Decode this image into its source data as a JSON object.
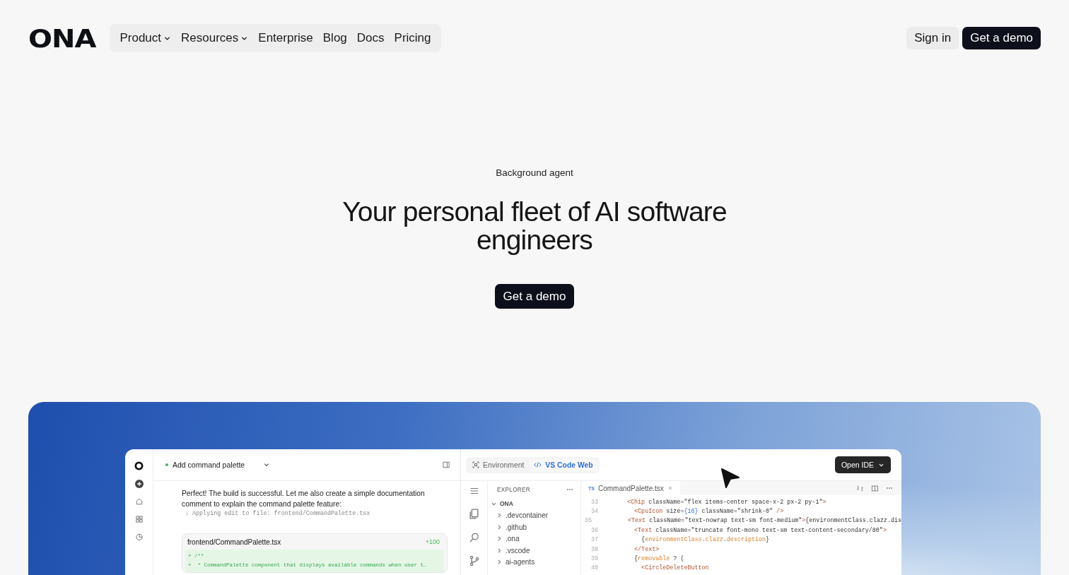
{
  "header": {
    "logo": "ONA",
    "nav": [
      {
        "label": "Product",
        "dropdown": true
      },
      {
        "label": "Resources",
        "dropdown": true
      },
      {
        "label": "Enterprise",
        "dropdown": false
      },
      {
        "label": "Blog",
        "dropdown": false
      },
      {
        "label": "Docs",
        "dropdown": false
      },
      {
        "label": "Pricing",
        "dropdown": false
      }
    ],
    "actions": [
      {
        "label": "Sign in",
        "kind": "secondary"
      },
      {
        "label": "Get a demo",
        "kind": "primary"
      }
    ]
  },
  "hero": {
    "eyebrow": "Background agent",
    "title": "Your personal fleet of AI software engineers",
    "button": "Get a demo"
  },
  "app": {
    "chat": {
      "task": "Add command palette",
      "message": "Perfect! The build is successful. Let me also create a simple documentation comment to explain the command palette feature:",
      "step": "Applying edit to file: frontend/CommandPalette.tsx",
      "diff": {
        "file": "frontend/CommandPalette.tsx",
        "added": "+100",
        "lines": [
          "+ /**",
          "+  * CommandPalette component that displays available commands when user t…"
        ]
      }
    },
    "ide": {
      "tabs": [
        {
          "label": "Environment",
          "selected": false
        },
        {
          "label": "VS Code Web",
          "selected": true
        }
      ],
      "open_button": "Open IDE",
      "explorer": {
        "title": "EXPLORER",
        "root": {
          "label": "ONA",
          "expanded": true,
          "children": [
            {
              "label": ".devcontainer",
              "expanded": false
            },
            {
              "label": ".github",
              "expanded": false
            },
            {
              "label": ".ona",
              "expanded": false
            },
            {
              "label": ".vscode",
              "expanded": false
            },
            {
              "label": "ai-agents",
              "expanded": false
            }
          ]
        }
      },
      "editor_tab": {
        "lang": "TS",
        "file": "CommandPalette.tsx"
      },
      "code": [
        {
          "number": "33",
          "tokens": [
            {
              "kind": "tag",
              "text": "<Chip"
            },
            {
              "kind": "plain",
              "text": " className="
            },
            {
              "kind": "str",
              "text": "\"flex items-center space-x-2 px-2 py-1\""
            },
            {
              "kind": "tag",
              "text": ">"
            }
          ]
        },
        {
          "number": "34",
          "tokens": [
            {
              "kind": "tag",
              "text": "  <CpuIcon"
            },
            {
              "kind": "plain",
              "text": " size="
            },
            {
              "kind": "num",
              "text": "{16}"
            },
            {
              "kind": "plain",
              "text": " className="
            },
            {
              "kind": "str",
              "text": "\"shrink-0\""
            },
            {
              "kind": "tag",
              "text": " />"
            }
          ]
        },
        {
          "number": "35",
          "tokens": [
            {
              "kind": "tag",
              "text": "  <Text"
            },
            {
              "kind": "plain",
              "text": " className="
            },
            {
              "kind": "str",
              "text": "\"text-nowrap text-sm font-medium\""
            },
            {
              "kind": "tag",
              "text": ">"
            },
            {
              "kind": "plain",
              "text": "{environmentClass.clazz.dis"
            }
          ]
        },
        {
          "number": "36",
          "tokens": [
            {
              "kind": "tag",
              "text": "  <Text"
            },
            {
              "kind": "plain",
              "text": " className="
            },
            {
              "kind": "str",
              "text": "\"truncate font-mono text-sm text-content-secondary/80\""
            },
            {
              "kind": "tag",
              "text": ">"
            }
          ]
        },
        {
          "number": "37",
          "tokens": [
            {
              "kind": "plain",
              "text": "    {"
            },
            {
              "kind": "var",
              "text": "environmentClass"
            },
            {
              "kind": "plain",
              "text": "."
            },
            {
              "kind": "var",
              "text": "clazz"
            },
            {
              "kind": "plain",
              "text": "."
            },
            {
              "kind": "var",
              "text": "description"
            },
            {
              "kind": "plain",
              "text": "}"
            }
          ]
        },
        {
          "number": "38",
          "tokens": [
            {
              "kind": "tag",
              "text": "  </Text>"
            }
          ]
        },
        {
          "number": "39",
          "tokens": [
            {
              "kind": "plain",
              "text": "  {"
            },
            {
              "kind": "var",
              "text": "removable"
            },
            {
              "kind": "plain",
              "text": " ? ("
            }
          ]
        },
        {
          "number": "40",
          "tokens": [
            {
              "kind": "tag",
              "text": "    <CircleDeleteButton"
            }
          ]
        }
      ]
    }
  }
}
